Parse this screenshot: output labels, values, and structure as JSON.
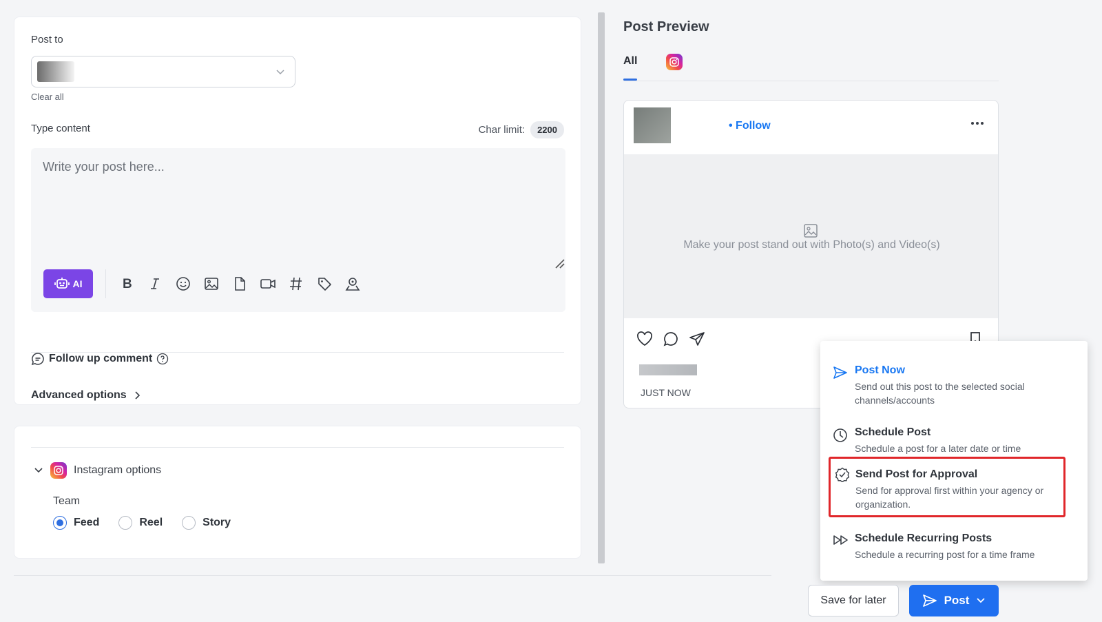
{
  "composer": {
    "post_to_label": "Post to",
    "clear_all": "Clear all",
    "type_content_label": "Type content",
    "char_limit_label": "Char limit:",
    "char_limit_value": "2200",
    "editor_placeholder": "Write your post here...",
    "ai_label": "AI",
    "toolbar_icons": [
      "bold-icon",
      "italic-icon",
      "emoji-icon",
      "image-icon",
      "file-icon",
      "video-icon",
      "hashtag-icon",
      "tag-icon",
      "location-icon"
    ],
    "follow_up_label": "Follow up comment",
    "advanced_label": "Advanced options"
  },
  "instagram_options": {
    "header": "Instagram options",
    "team_label": "Team",
    "formats": [
      {
        "label": "Feed",
        "selected": true
      },
      {
        "label": "Reel",
        "selected": false
      },
      {
        "label": "Story",
        "selected": false
      }
    ]
  },
  "preview": {
    "title": "Post Preview",
    "tab_all": "All",
    "follow": "• Follow",
    "media_hint": "Make your post stand out with Photo(s) and Video(s)",
    "timestamp": "JUST NOW"
  },
  "post_menu": {
    "items": [
      {
        "title": "Post Now",
        "desc": "Send out this post to the selected social channels/accounts",
        "icon": "send-icon"
      },
      {
        "title": "Schedule Post",
        "desc": "Schedule a post for a later date or time",
        "icon": "clock-icon"
      },
      {
        "title": "Send Post for Approval",
        "desc": "Send for approval first within your agency or organization.",
        "icon": "approval-badge-icon"
      },
      {
        "title": "Schedule Recurring Posts",
        "desc": "Schedule a recurring post for a time frame",
        "icon": "recurring-icon"
      }
    ]
  },
  "actions": {
    "save_for_later": "Save for later",
    "post": "Post"
  },
  "colors": {
    "accent": "#1f6ff0",
    "ai": "#7b45e6",
    "highlight": "#e0262a"
  }
}
